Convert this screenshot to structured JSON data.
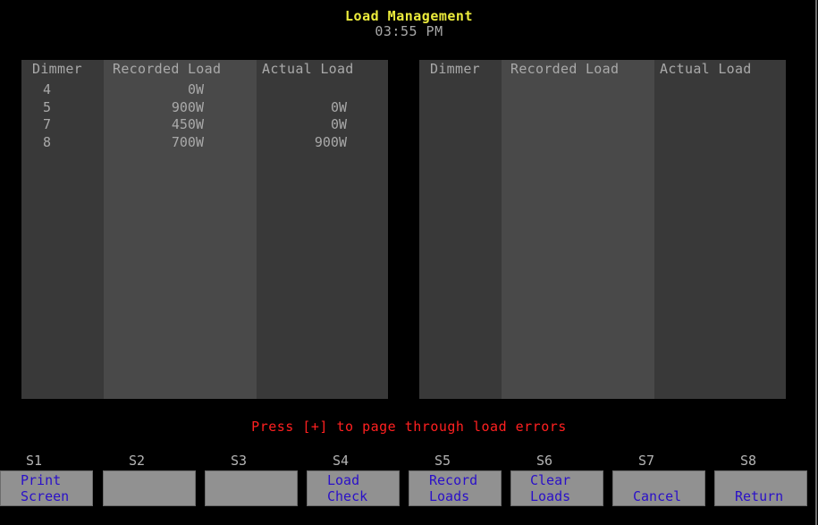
{
  "header": {
    "title": "Load Management",
    "time": "03:55 PM"
  },
  "tables": [
    {
      "columns": [
        "Dimmer",
        "Recorded Load",
        "Actual Load"
      ],
      "rows": [
        {
          "dimmer": "4",
          "recorded": "0W",
          "actual": ""
        },
        {
          "dimmer": "5",
          "recorded": "900W",
          "actual": "0W"
        },
        {
          "dimmer": "7",
          "recorded": "450W",
          "actual": "0W"
        },
        {
          "dimmer": "8",
          "recorded": "700W",
          "actual": "900W"
        }
      ]
    },
    {
      "columns": [
        "Dimmer",
        "Recorded Load",
        "Actual Load"
      ],
      "rows": []
    }
  ],
  "status_message": "Press [+] to page through load errors",
  "softkeys": [
    {
      "key": "S1",
      "line1": "Print",
      "line2": "Screen"
    },
    {
      "key": "S2",
      "line1": "",
      "line2": ""
    },
    {
      "key": "S3",
      "line1": "",
      "line2": ""
    },
    {
      "key": "S4",
      "line1": "Load",
      "line2": "Check"
    },
    {
      "key": "S5",
      "line1": "Record",
      "line2": "Loads"
    },
    {
      "key": "S6",
      "line1": "Clear",
      "line2": "Loads"
    },
    {
      "key": "S7",
      "line1": "",
      "line2": "Cancel"
    },
    {
      "key": "S8",
      "line1": "",
      "line2": "Return"
    }
  ],
  "colors": {
    "title": "#ecec3c",
    "status_message": "#ff2020",
    "softkey_text": "#2a10c8",
    "softkey_bg": "#919191"
  }
}
